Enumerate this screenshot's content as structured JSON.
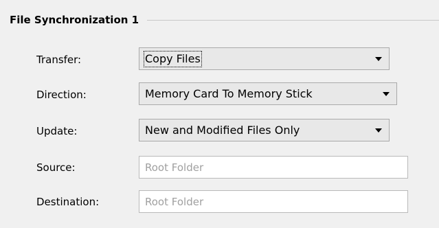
{
  "group": {
    "title": "File Synchronization 1"
  },
  "transfer": {
    "label": "Transfer:",
    "value": "Copy Files"
  },
  "direction": {
    "label": "Direction:",
    "value": "Memory Card To Memory Stick"
  },
  "update": {
    "label": "Update:",
    "value": "New and Modified Files Only"
  },
  "source": {
    "label": "Source:",
    "placeholder": "Root Folder"
  },
  "destination": {
    "label": "Destination:",
    "placeholder": "Root Folder"
  }
}
